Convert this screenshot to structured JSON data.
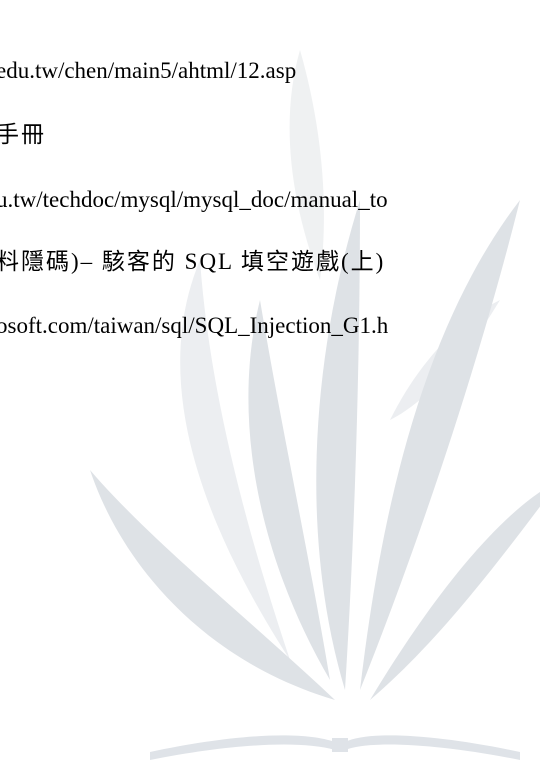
{
  "document": {
    "lines": [
      "edu.tw/chen/main5/ahtml/12.asp",
      "手冊",
      "u.tw/techdoc/mysql/mysql_doc/manual_to",
      "料隱碼)– 駭客的 SQL 填空遊戲(上)",
      "osoft.com/taiwan/sql/SQL_Injection_G1.h"
    ]
  },
  "colors": {
    "text": "#000000",
    "watermark": "#d9dde2",
    "background": "#ffffff"
  }
}
